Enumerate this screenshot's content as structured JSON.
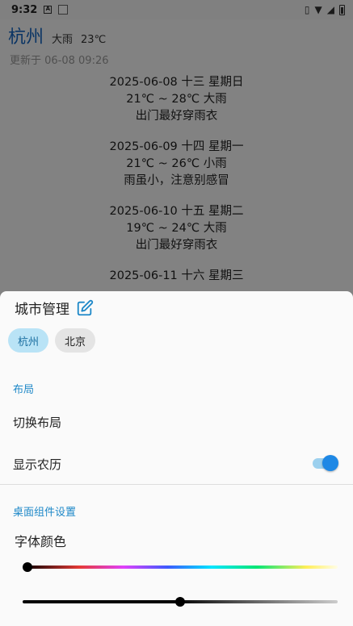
{
  "status_bar": {
    "time": "9:32"
  },
  "header": {
    "city": "杭州",
    "weather": "大雨",
    "temp": "23℃"
  },
  "updated": "更新于 06-08 09:26",
  "forecast": [
    {
      "date_line": "2025-06-08   十三   星期日",
      "temp_line": "21℃ ~ 28℃   大雨",
      "tip": "出门最好穿雨衣"
    },
    {
      "date_line": "2025-06-09   十四   星期一",
      "temp_line": "21℃ ~ 26℃   小雨",
      "tip": "雨虽小，注意别感冒"
    },
    {
      "date_line": "2025-06-10   十五   星期二",
      "temp_line": "19℃ ~ 24℃   大雨",
      "tip": "出门最好穿雨衣"
    },
    {
      "date_line": "2025-06-11   十六   星期三",
      "temp_line": "",
      "tip": ""
    }
  ],
  "sheet": {
    "title": "城市管理",
    "cities": [
      {
        "label": "杭州",
        "active": true
      },
      {
        "label": "北京",
        "active": false
      }
    ],
    "layout_section": "布局",
    "switch_layout": "切换布局",
    "show_lunar": "显示农历",
    "show_lunar_enabled": true,
    "widget_section": "桌面组件设置",
    "font_color": "字体颜色",
    "hue_slider_value": 0,
    "brightness_slider_value": 0.5
  },
  "colors": {
    "accent": "#1e88e5",
    "city_title": "#1565c0",
    "section_label": "#1e88c8"
  }
}
